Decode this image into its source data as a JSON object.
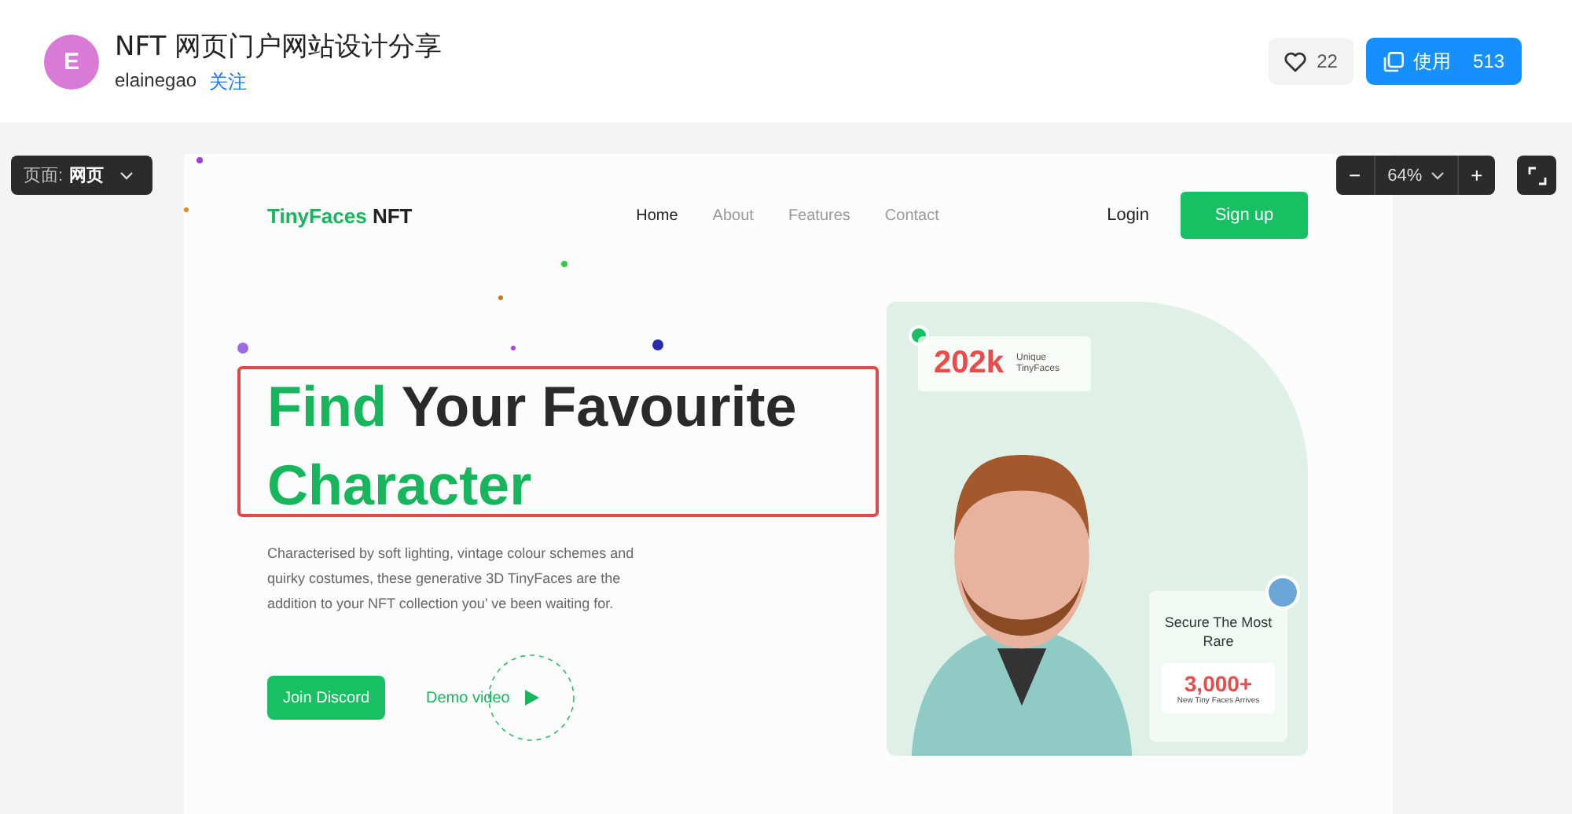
{
  "header": {
    "avatar_letter": "E",
    "title": "NFT 网页门户网站设计分享",
    "author": "elainegao",
    "follow": "关注",
    "likes": "22",
    "use_label": "使用",
    "use_count": "513"
  },
  "canvas_controls": {
    "page_label": "页面:",
    "page_value": "网页",
    "zoom_out": "−",
    "zoom": "64%",
    "zoom_in": "+"
  },
  "design": {
    "logo": {
      "name": "TinyFaces",
      "suffix": "NFT"
    },
    "nav": [
      {
        "label": "Home",
        "selected": true
      },
      {
        "label": "About",
        "selected": false
      },
      {
        "label": "Features",
        "selected": false
      },
      {
        "label": "Contact",
        "selected": false
      }
    ],
    "login": "Login",
    "signup": "Sign up",
    "headline": [
      {
        "text": "Find",
        "accent": true
      },
      {
        "text": "Your Favourite",
        "accent": false
      },
      {
        "text": "Character",
        "accent": true
      }
    ],
    "headline_selected": true,
    "paragraph": "Characterised by soft lighting, vintage colour schemes and quirky costumes, these generative 3D TinyFaces are the addition to your NFT collection you’ ve been waiting for.",
    "join_button": "Join Discord",
    "demo_link": "Demo video",
    "stat_card": {
      "value": "202k",
      "label": "Unique TinyFaces"
    },
    "rare_card": {
      "title": "Secure The Most Rare",
      "value": "3,000+",
      "caption": "New Tiny Faces Arrives"
    }
  }
}
